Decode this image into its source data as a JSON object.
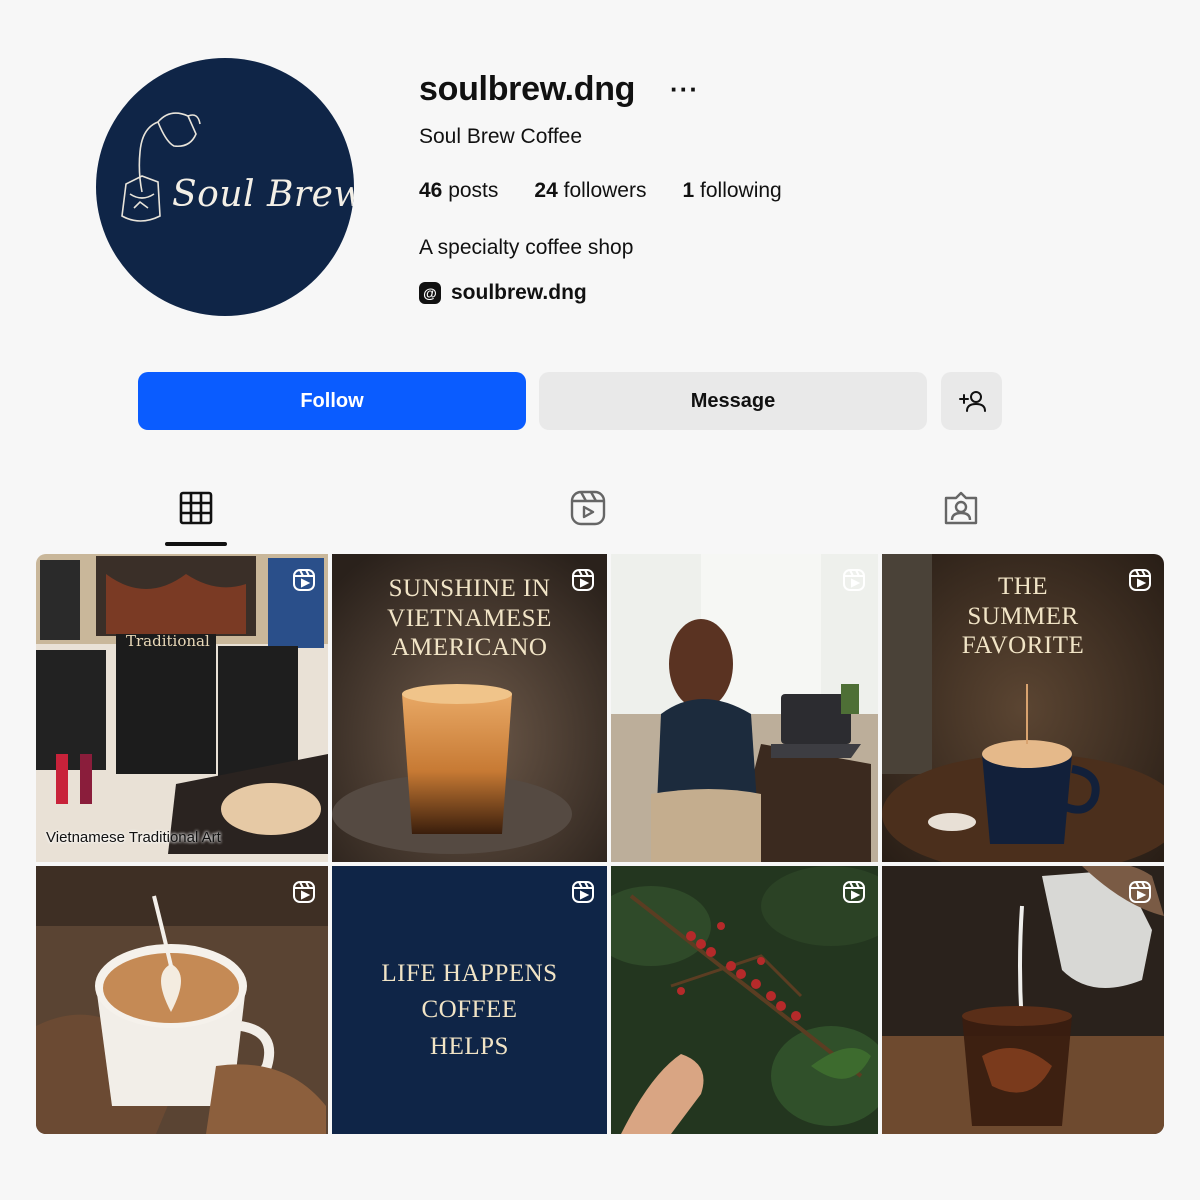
{
  "profile": {
    "username": "soulbrew.dng",
    "more_label": "···",
    "full_name": "Soul Brew Coffee",
    "stats": {
      "posts_count": "46",
      "posts_label": "posts",
      "followers_count": "24",
      "followers_label": "followers",
      "following_count": "1",
      "following_label": "following"
    },
    "bio": "A specialty coffee shop",
    "threads_handle": "soulbrew.dng",
    "avatar_logo_text": "Soul Brew",
    "avatar_color": "#0f2547"
  },
  "actions": {
    "follow_label": "Follow",
    "message_label": "Message",
    "follow_color": "#0a5cff"
  },
  "tabs": [
    {
      "icon": "grid-icon",
      "active": true
    },
    {
      "icon": "reels-icon",
      "active": false
    },
    {
      "icon": "tagged-icon",
      "active": false
    }
  ],
  "posts": [
    {
      "type": "reel",
      "caption": "Vietnamese Traditional Art"
    },
    {
      "type": "reel",
      "title_lines": [
        "SUNSHINE IN",
        "VIETNAMESE",
        "AMERICANO"
      ]
    },
    {
      "type": "reel"
    },
    {
      "type": "reel",
      "title_lines": [
        "THE",
        "SUMMER",
        "FAVORITE"
      ]
    },
    {
      "type": "reel"
    },
    {
      "type": "reel",
      "title_lines": [
        "LIFE HAPPENS",
        "COFFEE",
        "HELPS"
      ]
    },
    {
      "type": "reel"
    },
    {
      "type": "reel"
    }
  ]
}
